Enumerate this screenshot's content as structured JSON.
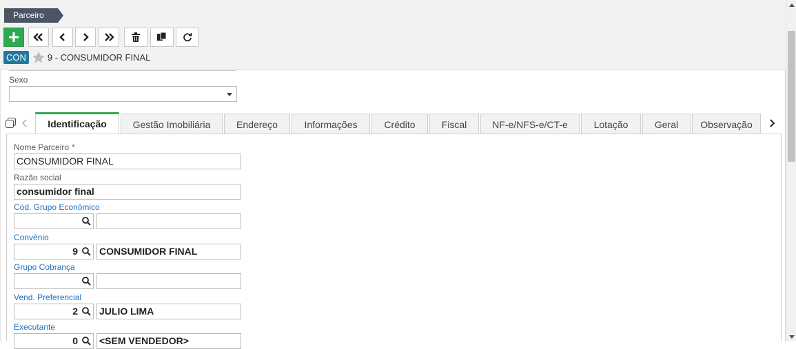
{
  "breadcrumb": "Parceiro",
  "toolbar": {
    "icons": [
      "add-icon",
      "first-record-icon",
      "previous-record-icon",
      "next-record-icon",
      "last-record-icon",
      "delete-icon",
      "duplicate-icon",
      "refresh-icon"
    ]
  },
  "record": {
    "badge": "CON",
    "title": "9 - CONSUMIDOR FINAL"
  },
  "form_top": {
    "sexo_label": "Sexo",
    "sexo_value": ""
  },
  "tabs": [
    {
      "label": "Identificação"
    },
    {
      "label": "Gestão Imobiliária"
    },
    {
      "label": "Endereço"
    },
    {
      "label": "Informações"
    },
    {
      "label": "Crédito"
    },
    {
      "label": "Fiscal"
    },
    {
      "label": "NF-e/NFS-e/CT-e"
    },
    {
      "label": "Lotação"
    },
    {
      "label": "Geral"
    },
    {
      "label": "Observação"
    }
  ],
  "fields": {
    "nome_label": "Nome Parceiro",
    "nome_required": "*",
    "nome_value": "CONSUMIDOR FINAL",
    "razao_label": "Razão social",
    "razao_value": "consumidor final",
    "grupo_eco_label": "Cód. Grupo Econômico",
    "grupo_eco_code": "",
    "grupo_eco_desc": "",
    "convenio_label": "Convênio",
    "convenio_code": "9",
    "convenio_desc": "CONSUMIDOR FINAL",
    "grupo_cob_label": "Grupo Cobrança",
    "grupo_cob_code": "",
    "grupo_cob_desc": "",
    "vend_label": "Vend. Preferencial",
    "vend_code": "2",
    "vend_desc": "JULIO LIMA",
    "exec_label": "Executante",
    "exec_code": "0",
    "exec_desc": "<SEM VENDEDOR>"
  },
  "colors": {
    "accent_green": "#2fa84f",
    "badge_blue": "#1f7a9e",
    "breadcrumb_bg": "#4a5563",
    "link_blue": "#1f6fc2"
  }
}
